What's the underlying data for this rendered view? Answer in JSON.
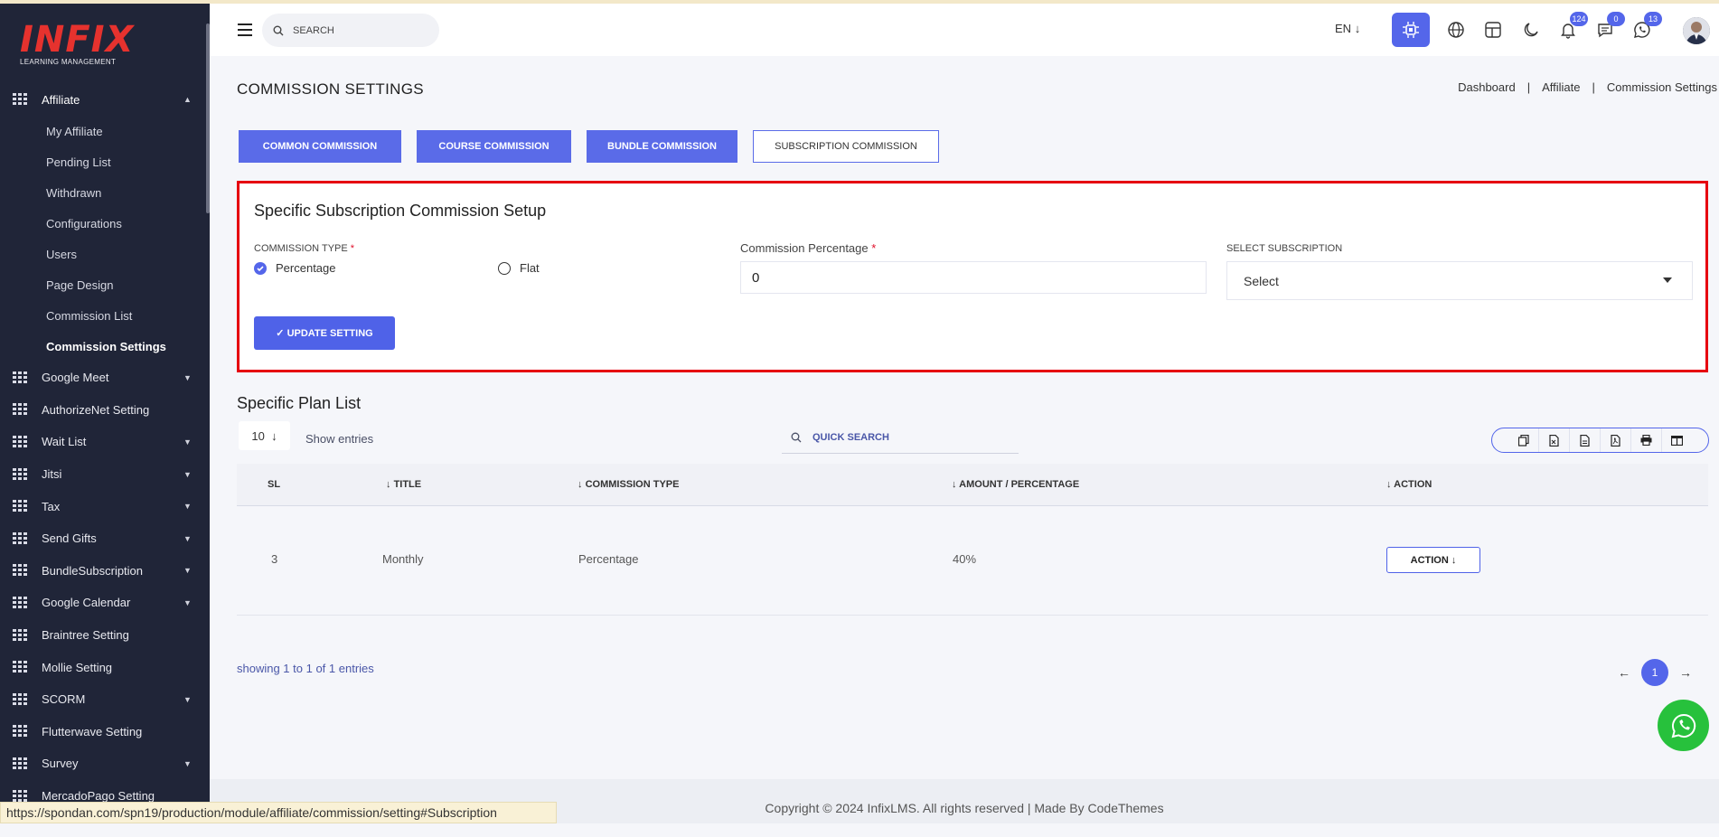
{
  "logo": {
    "brand": "INFIX",
    "subtitle": "LEARNING MANAGEMENT"
  },
  "sidebar": {
    "group": {
      "label": "Affiliate",
      "icon": "grid-icon"
    },
    "subitems": [
      "My Affiliate",
      "Pending List",
      "Withdrawn",
      "Configurations",
      "Users",
      "Page Design",
      "Commission List",
      "Commission Settings"
    ],
    "active_subitem": "Commission Settings",
    "items": [
      {
        "label": "Google Meet",
        "has_caret": true
      },
      {
        "label": "AuthorizeNet Setting",
        "has_caret": false
      },
      {
        "label": "Wait List",
        "has_caret": true
      },
      {
        "label": "Jitsi",
        "has_caret": true
      },
      {
        "label": "Tax",
        "has_caret": true
      },
      {
        "label": "Send Gifts",
        "has_caret": true
      },
      {
        "label": "BundleSubscription",
        "has_caret": true
      },
      {
        "label": "Google Calendar",
        "has_caret": true
      },
      {
        "label": "Braintree Setting",
        "has_caret": false
      },
      {
        "label": "Mollie Setting",
        "has_caret": false
      },
      {
        "label": "SCORM",
        "has_caret": true
      },
      {
        "label": "Flutterwave Setting",
        "has_caret": false
      },
      {
        "label": "Survey",
        "has_caret": true
      },
      {
        "label": "MercadoPago Setting",
        "has_caret": false
      }
    ]
  },
  "header": {
    "search_placeholder": "SEARCH",
    "language": "EN",
    "badges": {
      "notifications": "124",
      "messages": "0",
      "whatsapp": "13"
    }
  },
  "page": {
    "title": "COMMISSION SETTINGS",
    "breadcrumb": [
      "Dashboard",
      "Affiliate",
      "Commission Settings"
    ]
  },
  "tabs": [
    "COMMON COMMISSION",
    "COURSE COMMISSION",
    "BUNDLE COMMISSION",
    "SUBSCRIPTION COMMISSION"
  ],
  "form": {
    "heading": "Specific Subscription Commission Setup",
    "commission_type_label": "COMMISSION TYPE",
    "option_percentage": "Percentage",
    "option_flat": "Flat",
    "selected_type": "Percentage",
    "percentage_label": "Commission Percentage",
    "percentage_value": "0",
    "subscription_label": "SELECT SUBSCRIPTION",
    "subscription_value": "Select",
    "update_button": "✓ UPDATE SETTING",
    "highlight_color": "#e60010"
  },
  "list": {
    "title": "Specific Plan List",
    "entries": "10",
    "entries_label": "Show entries",
    "quick_search_placeholder": "QUICK SEARCH",
    "columns": [
      "SL",
      "TITLE",
      "COMMISSION TYPE",
      "AMOUNT / PERCENTAGE",
      "ACTION"
    ],
    "rows": [
      {
        "sl": "3",
        "title": "Monthly",
        "type": "Percentage",
        "amount": "40%",
        "action": "ACTION"
      }
    ],
    "showing": "showing 1 to 1 of 1 entries",
    "current_page": "1"
  },
  "footer": {
    "text": "Copyright © 2024 InfixLMS. All rights reserved | Made By CodeThemes"
  },
  "statusbar": {
    "url": "https://spondan.com/spn19/production/module/affiliate/commission/setting#Subscription"
  },
  "colors": {
    "primary": "#5466ea",
    "sidebar": "#202538",
    "whatsapp": "#27c13c"
  }
}
